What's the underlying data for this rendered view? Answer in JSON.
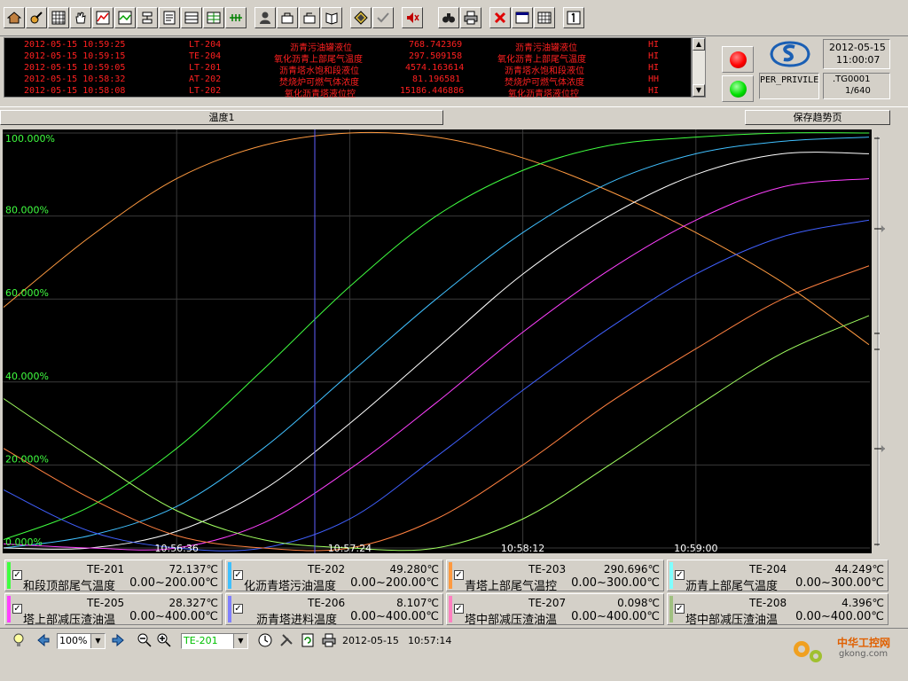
{
  "alarms": [
    {
      "time": "2012-05-15 10:59:25",
      "tag": "LT-204",
      "desc": "沥青污油罐液位",
      "value": "768.742369",
      "desc2": "沥青污油罐液位",
      "level": "HI"
    },
    {
      "time": "2012-05-15 10:59:15",
      "tag": "TE-204",
      "desc": "氧化沥青上部尾气温度",
      "value": "297.509158",
      "desc2": "氧化沥青上部尾气温度",
      "level": "HI"
    },
    {
      "time": "2012-05-15 10:59:05",
      "tag": "LT-201",
      "desc": "沥青塔水饱和段液位",
      "value": "4574.163614",
      "desc2": "沥青塔水饱和段液位",
      "level": "HI"
    },
    {
      "time": "2012-05-15 10:58:32",
      "tag": "AT-202",
      "desc": "焚烧炉可燃气体浓度",
      "value": "81.196581",
      "desc2": "焚烧炉可燃气体浓度",
      "level": "HH"
    },
    {
      "time": "2012-05-15 10:58:08",
      "tag": "LT-202",
      "desc": "氧化沥青塔液位控",
      "value": "15186.446886",
      "desc2": "氧化沥青塔液位控",
      "level": "HI"
    }
  ],
  "header": {
    "date": "2012-05-15",
    "time": "11:00:07",
    "user": "PER_PRIVILE",
    "page_id": ".TG0001",
    "page_num": "1/640"
  },
  "tabs": {
    "left": "温度1",
    "right": "保存趋势页"
  },
  "chart_data": {
    "type": "line",
    "ylim": [
      0,
      100
    ],
    "y_ticks": [
      "100.000%",
      "80.000%",
      "60.000%",
      "40.000%",
      "20.000%",
      "0.000%"
    ],
    "x_ticks": [
      "10:56:36",
      "10:57:24",
      "10:58:12",
      "10:59:00"
    ],
    "background": "#000000",
    "grid": true,
    "cursor_time": "10:57:14",
    "series": [
      {
        "name": "TE-201",
        "color": "#ff9a40",
        "x": [
          0,
          0.1,
          0.2,
          0.3,
          0.4,
          0.5,
          0.6,
          0.7,
          0.8,
          0.9,
          1.0
        ],
        "values": [
          58,
          75,
          89,
          97,
          100,
          99,
          94,
          86,
          76,
          64,
          49
        ]
      },
      {
        "name": "TE-202",
        "color": "#40ff40",
        "x": [
          0,
          0.1,
          0.2,
          0.3,
          0.4,
          0.5,
          0.6,
          0.7,
          0.8,
          0.9,
          1.0
        ],
        "values": [
          2,
          10,
          24,
          43,
          63,
          80,
          91,
          97,
          99,
          100,
          100
        ]
      },
      {
        "name": "TE-203",
        "color": "#40c0ff",
        "x": [
          0,
          0.1,
          0.2,
          0.3,
          0.4,
          0.5,
          0.6,
          0.7,
          0.8,
          0.9,
          1.0
        ],
        "values": [
          0,
          3,
          10,
          24,
          42,
          60,
          76,
          88,
          95,
          98,
          99
        ]
      },
      {
        "name": "TE-204",
        "color": "#ffffff",
        "x": [
          0,
          0.1,
          0.2,
          0.3,
          0.4,
          0.5,
          0.6,
          0.7,
          0.8,
          0.9,
          1.0
        ],
        "values": [
          0,
          0,
          4,
          14,
          30,
          48,
          66,
          80,
          90,
          95,
          95
        ]
      },
      {
        "name": "TE-205",
        "color": "#ff40ff",
        "x": [
          0,
          0.1,
          0.2,
          0.3,
          0.4,
          0.5,
          0.6,
          0.7,
          0.8,
          0.9,
          1.0
        ],
        "values": [
          1,
          0,
          0,
          6,
          19,
          35,
          52,
          67,
          79,
          87,
          89
        ]
      },
      {
        "name": "TE-206",
        "color": "#4060ff",
        "x": [
          0,
          0.1,
          0.2,
          0.3,
          0.4,
          0.5,
          0.6,
          0.7,
          0.8,
          0.9,
          1.0
        ],
        "values": [
          14,
          4,
          0,
          0,
          7,
          22,
          38,
          53,
          66,
          75,
          79
        ]
      },
      {
        "name": "TE-207",
        "color": "#ff8040",
        "x": [
          0,
          0.1,
          0.2,
          0.3,
          0.4,
          0.5,
          0.6,
          0.7,
          0.8,
          0.9,
          1.0
        ],
        "values": [
          24,
          12,
          3,
          0,
          0,
          7,
          20,
          35,
          48,
          60,
          68
        ]
      },
      {
        "name": "TE-208",
        "color": "#a0ff60",
        "x": [
          0,
          0.1,
          0.2,
          0.3,
          0.4,
          0.5,
          0.6,
          0.7,
          0.8,
          0.9,
          1.0
        ],
        "values": [
          36,
          22,
          9,
          2,
          0,
          0,
          7,
          20,
          34,
          47,
          56
        ]
      }
    ]
  },
  "legend": [
    {
      "tag": "TE-201",
      "value": "72.137℃",
      "name": "和段顶部尾气温度",
      "range": "0.00~200.00℃",
      "color": "#40ff40"
    },
    {
      "tag": "TE-202",
      "value": "49.280℃",
      "name": "化沥青塔污油温度",
      "range": "0.00~200.00℃",
      "color": "#40c0ff"
    },
    {
      "tag": "TE-203",
      "value": "290.696℃",
      "name": "青塔上部尾气温控",
      "range": "0.00~300.00℃",
      "color": "#ff9a40"
    },
    {
      "tag": "TE-204",
      "value": "44.249℃",
      "name": "沥青上部尾气温度",
      "range": "0.00~300.00℃",
      "color": "#80ffff"
    },
    {
      "tag": "TE-205",
      "value": "28.327℃",
      "name": "塔上部减压渣油温",
      "range": "0.00~400.00℃",
      "color": "#ff40ff"
    },
    {
      "tag": "TE-206",
      "value": "8.107℃",
      "name": "沥青塔进料温度",
      "range": "0.00~400.00℃",
      "color": "#8080ff"
    },
    {
      "tag": "TE-207",
      "value": "0.098℃",
      "name": "塔中部减压渣油温",
      "range": "0.00~400.00℃",
      "color": "#ff80c0"
    },
    {
      "tag": "TE-208",
      "value": "4.396℃",
      "name": "塔中部减压渣油温",
      "range": "0.00~400.00℃",
      "color": "#a0c080"
    }
  ],
  "bottom": {
    "zoom": "100%",
    "selected_tag": "TE-201",
    "date": "2012-05-15",
    "time": "10:57:14"
  },
  "watermark": {
    "brand": "中华工控网",
    "url": "gkong.com"
  }
}
